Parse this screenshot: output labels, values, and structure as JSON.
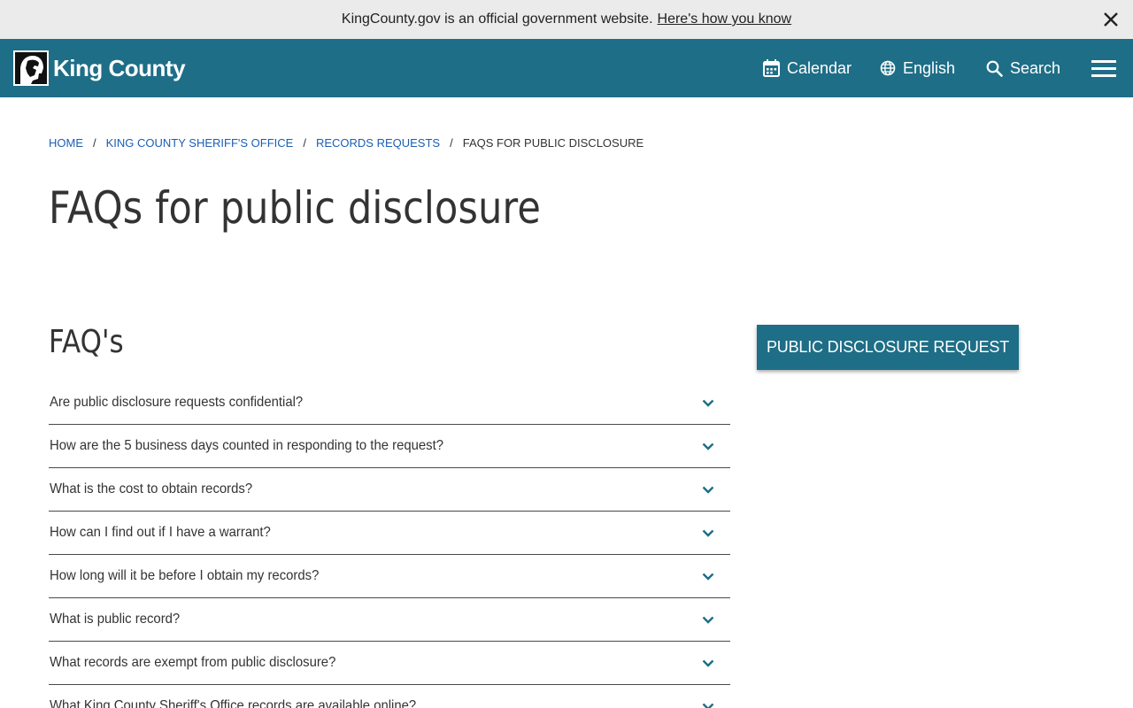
{
  "banner": {
    "text": "KingCounty.gov is an official government website.",
    "link": "Here's how you know",
    "close_icon": "close-icon"
  },
  "header": {
    "logo_text": "King County",
    "logo_icon": "king-county-logo-icon",
    "nav": {
      "calendar": "Calendar",
      "language": "English",
      "search": "Search"
    },
    "menu_icon": "hamburger-menu-icon",
    "colors": {
      "header_bg": "#1e6e87"
    }
  },
  "breadcrumb": {
    "items": [
      "HOME",
      "KING COUNTY SHERIFF'S OFFICE",
      "RECORDS REQUESTS"
    ],
    "current": "FAQS FOR PUBLIC DISCLOSURE",
    "separator": "/"
  },
  "page": {
    "title": "FAQs for public disclosure",
    "faq_heading": "FAQ's",
    "request_button": "PUBLIC DISCLOSURE REQUEST"
  },
  "faqs": [
    "Are public disclosure requests confidential?",
    "How are the 5 business days counted in responding to the request?",
    "What is the cost to obtain records?",
    "How can I find out if I have a warrant?",
    "How long will it be before I obtain my records?",
    "What is public record?",
    "What records are exempt from public disclosure?",
    "What King County Sheriff's Office records are available online?"
  ]
}
